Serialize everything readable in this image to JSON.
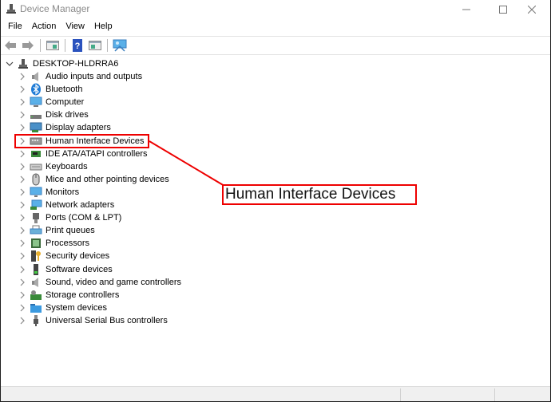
{
  "window": {
    "title": "Device Manager",
    "controls": {
      "minimize": "minimize",
      "maximize": "maximize",
      "close": "close"
    }
  },
  "menu": [
    "File",
    "Action",
    "View",
    "Help"
  ],
  "toolbar": {
    "buttons": [
      "back-icon",
      "forward-icon",
      "show-hide-console-tree-icon",
      "help-icon",
      "show-action-pane-icon",
      "scan-hardware-icon"
    ]
  },
  "tree": {
    "root": "DESKTOP-HLDRRA6",
    "items": [
      {
        "label": "Audio inputs and outputs",
        "icon": "speaker-icon"
      },
      {
        "label": "Bluetooth",
        "icon": "bluetooth-icon"
      },
      {
        "label": "Computer",
        "icon": "computer-icon"
      },
      {
        "label": "Disk drives",
        "icon": "disk-drive-icon"
      },
      {
        "label": "Display adapters",
        "icon": "display-adapter-icon"
      },
      {
        "label": "Human Interface Devices",
        "icon": "hid-icon"
      },
      {
        "label": "IDE ATA/ATAPI controllers",
        "icon": "ide-controller-icon"
      },
      {
        "label": "Keyboards",
        "icon": "keyboard-icon"
      },
      {
        "label": "Mice and other pointing devices",
        "icon": "mouse-icon"
      },
      {
        "label": "Monitors",
        "icon": "monitor-icon"
      },
      {
        "label": "Network adapters",
        "icon": "network-adapter-icon"
      },
      {
        "label": "Ports (COM & LPT)",
        "icon": "port-icon"
      },
      {
        "label": "Print queues",
        "icon": "printer-icon"
      },
      {
        "label": "Processors",
        "icon": "processor-icon"
      },
      {
        "label": "Security devices",
        "icon": "security-key-icon"
      },
      {
        "label": "Software devices",
        "icon": "software-device-icon"
      },
      {
        "label": "Sound, video and game controllers",
        "icon": "speaker-icon"
      },
      {
        "label": "Storage controllers",
        "icon": "storage-controller-icon"
      },
      {
        "label": "System devices",
        "icon": "system-folder-icon"
      },
      {
        "label": "Universal Serial Bus controllers",
        "icon": "usb-icon"
      }
    ]
  },
  "annotation": {
    "callout_text": "Human Interface Devices",
    "highlight_color": "#e00000"
  }
}
